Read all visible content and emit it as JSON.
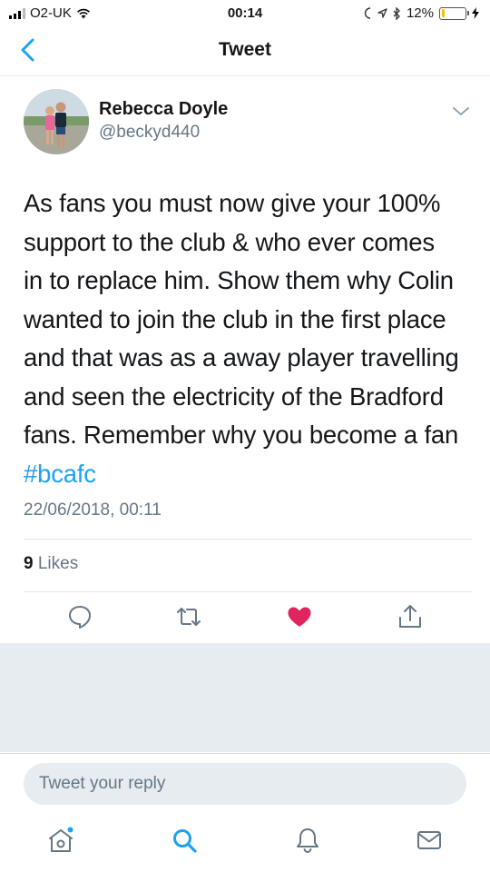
{
  "status_bar": {
    "carrier": "O2-UK",
    "time": "00:14",
    "battery_percent_text": "12%",
    "battery_level": 0.12,
    "icons": [
      "signal-icon",
      "wifi-icon",
      "moon-icon",
      "location-icon",
      "bluetooth-icon",
      "battery-icon",
      "charging-icon"
    ]
  },
  "nav": {
    "title": "Tweet",
    "back_icon": "chevron-left-icon"
  },
  "tweet": {
    "author_name": "Rebecca Doyle",
    "author_handle": "@beckyd440",
    "lines": [
      "As fans you must now give your 100%",
      "support to the club & who ever comes",
      "in to replace him. Show them why Colin",
      "wanted to join the club in the first place",
      "and that was as a away player travelling",
      "and seen the electricity of the Bradford",
      "fans. Remember why you become a fan"
    ],
    "hashtag": "#bcafc",
    "timestamp": "22/06/2018, 00:11",
    "likes_count": "9",
    "likes_label": "Likes",
    "liked": true
  },
  "actions": [
    "reply-icon",
    "retweet-icon",
    "like-icon",
    "share-icon"
  ],
  "reply": {
    "placeholder": "Tweet your reply"
  },
  "tabbar": {
    "items": [
      "home-icon",
      "search-icon",
      "notifications-icon",
      "messages-icon"
    ]
  },
  "colors": {
    "accent": "#1da1f2",
    "like": "#e0245e",
    "secondary_text": "#657786",
    "divider": "#e1e8ed",
    "background_grey": "#e6ecf0"
  }
}
